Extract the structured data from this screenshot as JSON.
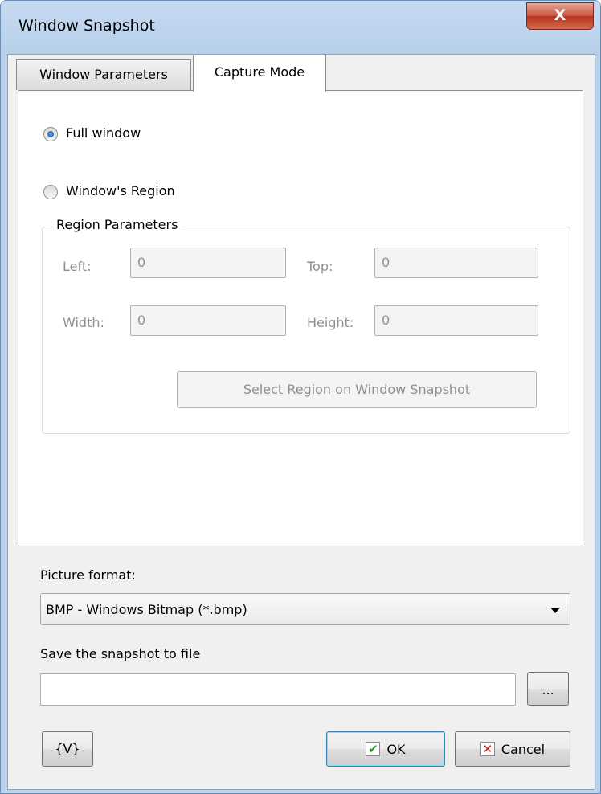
{
  "window": {
    "title": "Window Snapshot",
    "close_glyph": "X"
  },
  "tabs": [
    {
      "label": "Window Parameters",
      "active": false
    },
    {
      "label": "Capture Mode",
      "active": true
    }
  ],
  "capture_mode": {
    "options": [
      {
        "label": "Full window",
        "selected": true
      },
      {
        "label": "Window's Region",
        "selected": false
      }
    ],
    "region": {
      "legend": "Region Parameters",
      "left_label": "Left:",
      "left_value": "0",
      "top_label": "Top:",
      "top_value": "0",
      "width_label": "Width:",
      "width_value": "0",
      "height_label": "Height:",
      "height_value": "0",
      "select_button": "Select Region on Window Snapshot"
    }
  },
  "picture_format": {
    "label": "Picture format:",
    "selected": "BMP - Windows Bitmap (*.bmp)"
  },
  "save_file": {
    "label": "Save the snapshot to file",
    "value": "",
    "browse_label": "..."
  },
  "footer": {
    "variables_label": "{V}",
    "ok_label": "OK",
    "cancel_label": "Cancel",
    "ok_icon": "checkmark-icon",
    "cancel_icon": "x-icon"
  },
  "colors": {
    "window_frame": "#b9d1ea",
    "close_button": "#c9533f",
    "disabled_text": "#8f8f8f"
  }
}
